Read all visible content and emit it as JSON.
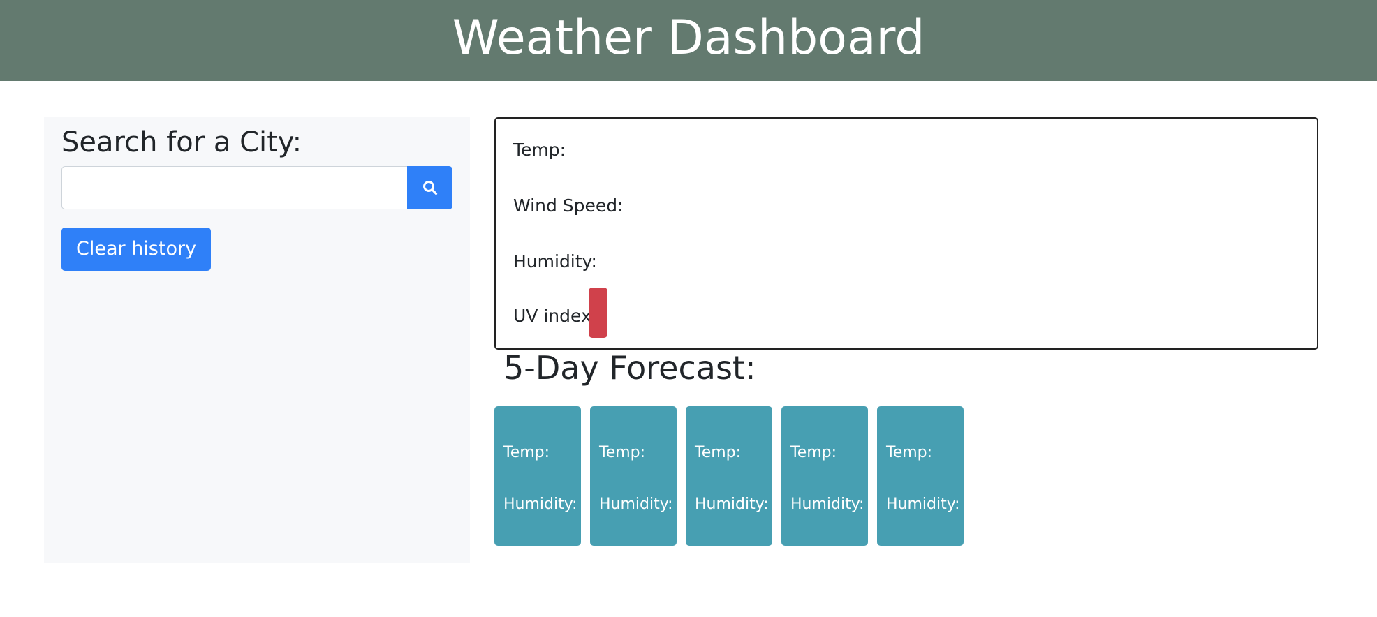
{
  "header": {
    "title": "Weather Dashboard"
  },
  "search": {
    "heading": "Search for a City:",
    "input_value": "",
    "placeholder": "",
    "search_icon": "search-icon",
    "clear_label": "Clear history"
  },
  "current": {
    "temp_label": "Temp:",
    "wind_label": "Wind Speed:",
    "humidity_label": "Humidity:",
    "uv_label": "UV index:",
    "uv_color": "#d0414b"
  },
  "forecast": {
    "title": "5-Day Forecast:",
    "days": [
      {
        "temp_label": "Temp:",
        "humidity_label": "Humidity:"
      },
      {
        "temp_label": "Temp:",
        "humidity_label": "Humidity:"
      },
      {
        "temp_label": "Temp:",
        "humidity_label": "Humidity:"
      },
      {
        "temp_label": "Temp:",
        "humidity_label": "Humidity:"
      },
      {
        "temp_label": "Temp:",
        "humidity_label": "Humidity:"
      }
    ]
  },
  "colors": {
    "header_bg": "#637a6f",
    "accent_blue": "#2f80f8",
    "forecast_card_bg": "#479fb2",
    "sidebar_bg": "#f7f8fa"
  }
}
